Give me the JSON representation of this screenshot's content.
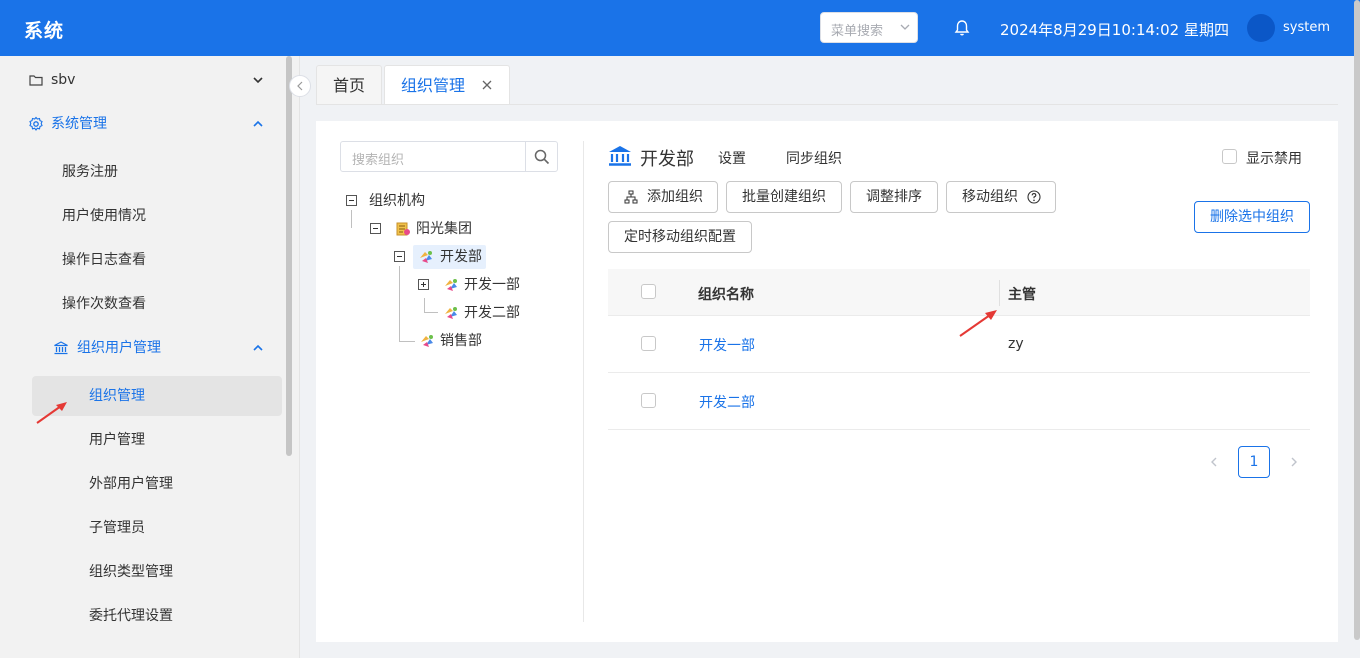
{
  "header": {
    "title": "系统",
    "menu_search_placeholder": "菜单搜索",
    "datetime": "2024年8月29日10:14:02 星期四",
    "username": "system",
    "accent_color": "#1a73e8"
  },
  "sidebar": {
    "items": [
      {
        "label": "sbv",
        "icon": "folder-icon"
      },
      {
        "label": "系统管理",
        "icon": "gear-icon"
      },
      {
        "label": "服务注册"
      },
      {
        "label": "用户使用情况"
      },
      {
        "label": "操作日志查看"
      },
      {
        "label": "操作次数查看"
      },
      {
        "label": "组织用户管理",
        "icon": "bank-icon"
      },
      {
        "label": "组织管理"
      },
      {
        "label": "用户管理"
      },
      {
        "label": "外部用户管理"
      },
      {
        "label": "子管理员"
      },
      {
        "label": "组织类型管理"
      },
      {
        "label": "委托代理设置"
      }
    ]
  },
  "tabs": [
    {
      "label": "首页"
    },
    {
      "label": "组织管理"
    }
  ],
  "tree": {
    "search_placeholder": "搜索组织",
    "nodes": [
      {
        "label": "组织机构"
      },
      {
        "label": "阳光集团"
      },
      {
        "label": "开发部"
      },
      {
        "label": "开发一部"
      },
      {
        "label": "开发二部"
      },
      {
        "label": "销售部"
      }
    ]
  },
  "panel": {
    "title": "开发部",
    "settings_label": "设置",
    "sync_label": "同步组织",
    "show_disabled_label": "显示禁用",
    "buttons": {
      "add": "添加组织",
      "batch_create": "批量创建组织",
      "adjust_order": "调整排序",
      "move": "移动组织",
      "scheduled_move": "定时移动组织配置",
      "delete_selected": "删除选中组织"
    }
  },
  "table": {
    "columns": [
      "组织名称",
      "主管"
    ],
    "rows": [
      {
        "name": "开发一部",
        "manager": "zy"
      },
      {
        "name": "开发二部",
        "manager": ""
      }
    ]
  },
  "pagination": {
    "current_page": "1"
  }
}
